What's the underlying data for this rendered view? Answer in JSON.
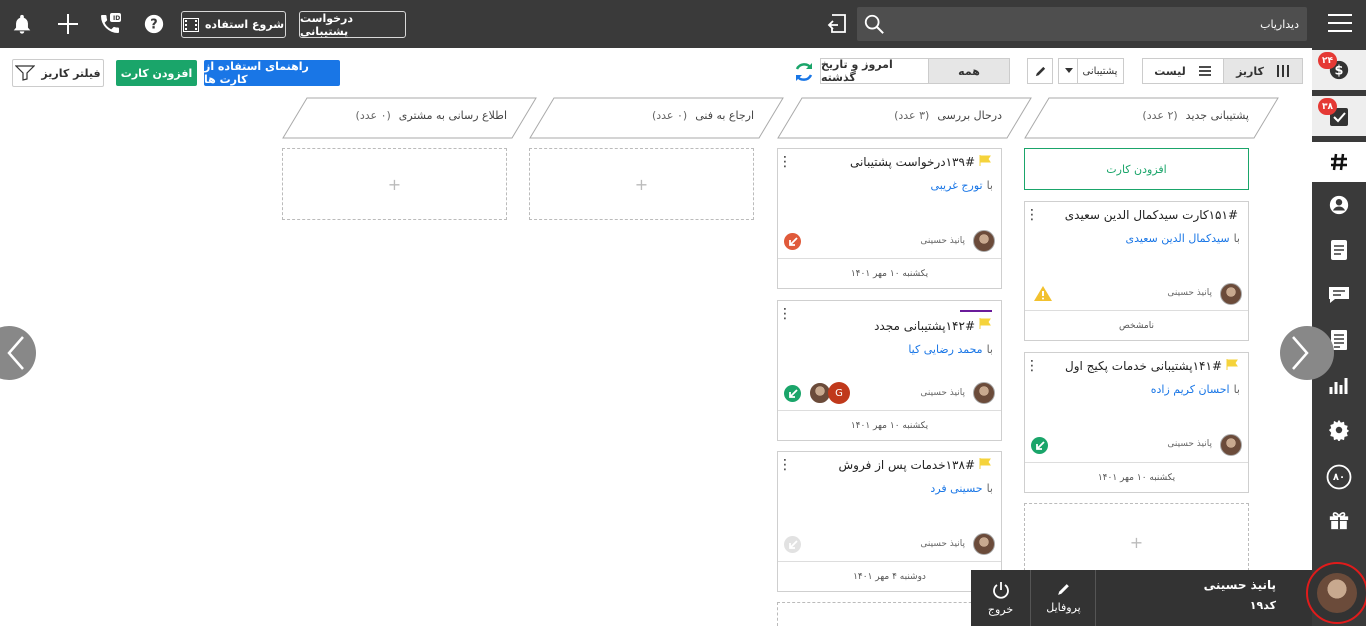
{
  "topbar": {
    "search_placeholder": "دیداریاب",
    "start_usage_label": "شروع استفاده",
    "support_request_label": "درخواست پشتیبانی",
    "phone_badge": "ID"
  },
  "sidebar": {
    "items": [
      {
        "icon": "dollar-icon",
        "badge": "۲۴"
      },
      {
        "icon": "task-check-icon",
        "badge": "۳۸"
      },
      {
        "icon": "hashtag-icon",
        "badge": ""
      },
      {
        "icon": "user-icon",
        "badge": ""
      },
      {
        "icon": "document-icon",
        "badge": ""
      },
      {
        "icon": "chat-icon",
        "badge": ""
      },
      {
        "icon": "invoice-icon",
        "badge": ""
      },
      {
        "icon": "report-chart-icon",
        "badge": ""
      },
      {
        "icon": "settings-gear-icon",
        "badge": ""
      },
      {
        "icon": "eighty-icon",
        "badge": "۸۰"
      },
      {
        "icon": "gift-icon",
        "badge": ""
      }
    ]
  },
  "toolbar": {
    "view_kanban": "کاریز",
    "view_list": "لیست",
    "pipeline_select": "پشتیبانی",
    "filter_all": "همه",
    "filter_today": "امروز و تاریخ گذشته",
    "guide_button": "راهنمای استفاده از کارت ها",
    "add_card_button": "افزودن کارت",
    "filter_kanban_button": "فیلتر کاریز"
  },
  "columns": [
    {
      "title": "پشتیبانی جدید",
      "count": "(۲ عدد)"
    },
    {
      "title": "درحال بررسی",
      "count": "(۳ عدد)"
    },
    {
      "title": "ارجاع به فنی",
      "count": "(۰ عدد)"
    },
    {
      "title": "اطلاع رسانی به مشتری",
      "count": "(۰ عدد)"
    }
  ],
  "col1": {
    "add_card": "افزودن کارت",
    "cards": [
      {
        "title": "۱۵۱#کارت سیدکمال الدین سعیدی",
        "with_label": "با",
        "with_name": "سیدکمال الدین سعیدی",
        "owner": "پانیذ حسینی",
        "footer": "نامشخص"
      },
      {
        "title": "۱۴۱#پشتیبانی خدمات پکیج اول",
        "with_label": "با",
        "with_name": "احسان کریم زاده",
        "owner": "پانیذ حسینی",
        "footer": "یکشنبه ۱۰ مهر ۱۴۰۱"
      }
    ]
  },
  "col2": {
    "cards": [
      {
        "title": "۱۳۹#درخواست پشتیبانی",
        "with_label": "با",
        "with_name": "تورج غریبی",
        "owner": "پانیذ حسینی",
        "footer": "یکشنبه ۱۰ مهر ۱۴۰۱"
      },
      {
        "title": "۱۴۲#پشتیبانی مجدد",
        "with_label": "با",
        "with_name": "محمد رضایی کیا",
        "owner": "پانیذ حسینی",
        "footer": "یکشنبه ۱۰ مهر ۱۴۰۱",
        "extra_avatar": "G"
      },
      {
        "title": "۱۳۸#خدمات پس از فروش",
        "with_label": "با",
        "with_name": "حسینی فرد",
        "owner": "پانیذ حسینی",
        "footer": "دوشنبه ۴ مهر ۱۴۰۱"
      }
    ]
  },
  "empty_plus": "+",
  "profile": {
    "name": "پانیذ حسینی",
    "code": "کد۱۹",
    "profile_label": "پروفایل",
    "logout_label": "خروج"
  },
  "colors": {
    "topbar_bg": "#3a3a3a",
    "accent_green": "#1aa56a",
    "accent_blue": "#1976e6",
    "badge_red": "#e53935"
  }
}
